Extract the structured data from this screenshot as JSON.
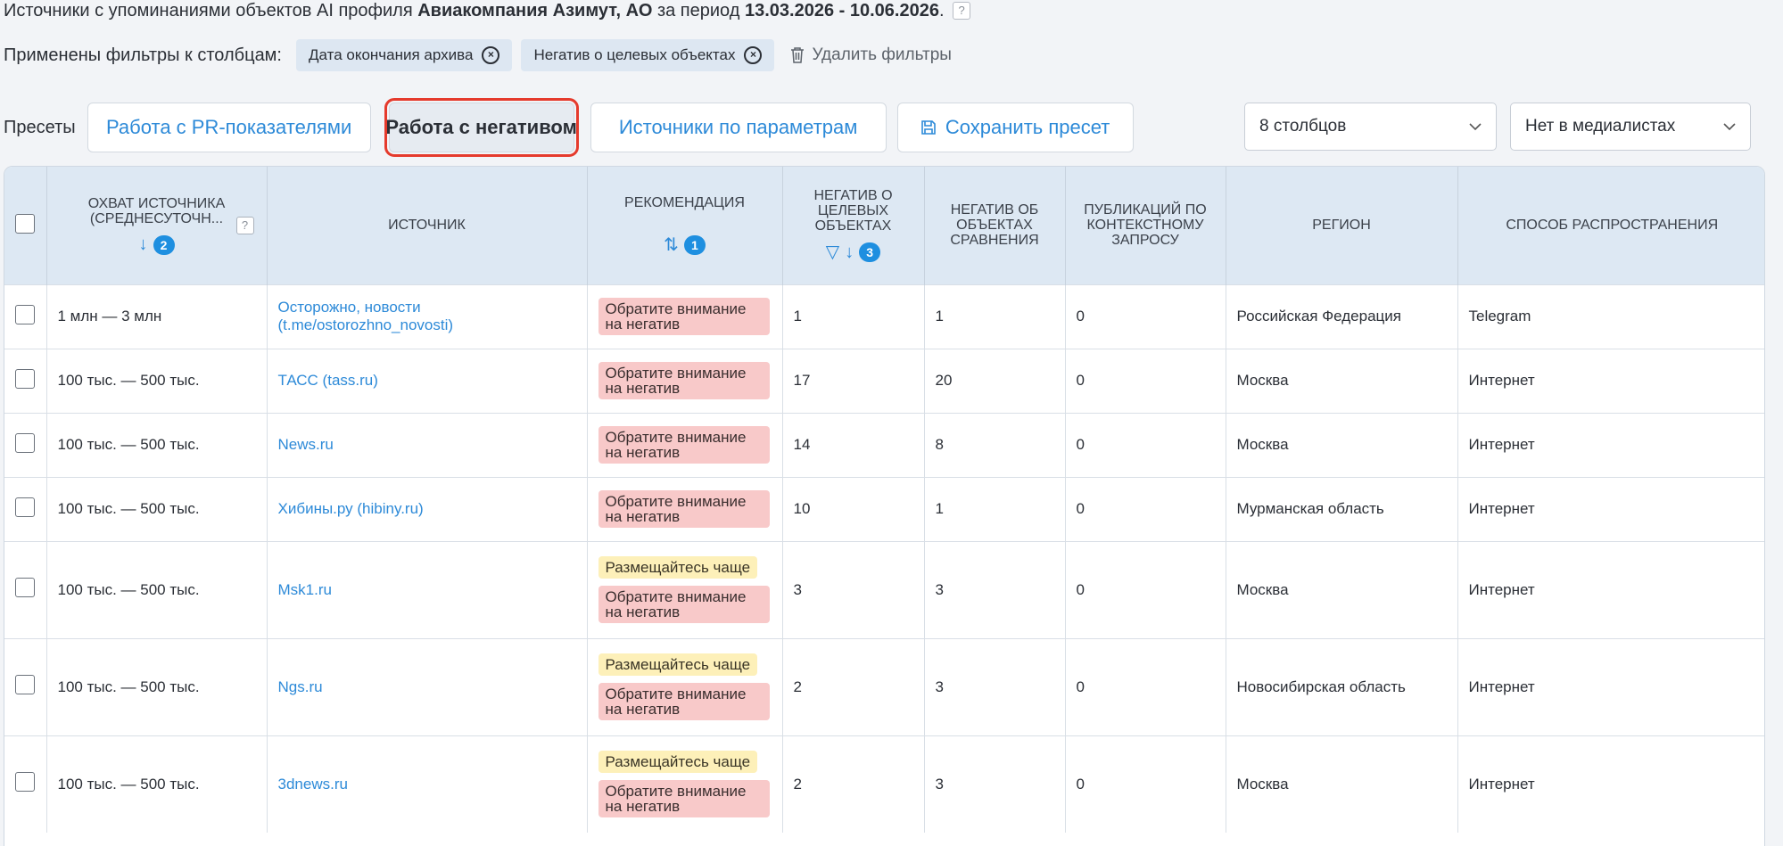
{
  "header": {
    "title_prefix": "Источники с упоминаниями объектов AI профиля ",
    "company": "Авиакомпания Азимут, АО",
    "period_word": " за период ",
    "period": "13.03.2026 - 10.06.2026",
    "dot": ".",
    "help": "?"
  },
  "filters": {
    "label": "Применены фильтры к столбцам:",
    "chips": [
      "Дата окончания архива",
      "Негатив о целевых объектах"
    ],
    "remove_label": "Удалить фильтры"
  },
  "presets": {
    "label": "Пресеты",
    "buttons": [
      "Работа с PR-показателями",
      "Работа с негативом",
      "Источники по параметрам"
    ],
    "active_index": 1,
    "save_label": "Сохранить пресет"
  },
  "selects": {
    "columns": "8 столбцов",
    "media": "Нет в медиалистах"
  },
  "table": {
    "headers": {
      "reach": "ОХВАТ ИСТОЧНИКА (СРЕДНЕСУТОЧН...",
      "reach_sort": "2",
      "source": "ИСТОЧНИК",
      "recommendation": "РЕКОМЕНДАЦИЯ",
      "recommendation_sort": "1",
      "neg_target": "НЕГАТИВ О ЦЕЛЕВЫХ ОБЪЕКТАХ",
      "neg_target_sort": "3",
      "neg_compare": "НЕГАТИВ ОБ ОБЪЕКТАХ СРАВНЕНИЯ",
      "publications": "ПУБЛИКАЦИЙ ПО КОНТЕКСТНОМУ ЗАПРОСУ",
      "region": "РЕГИОН",
      "distribution": "СПОСОБ РАСПРОСТРАНЕНИЯ",
      "help": "?"
    },
    "badges": {
      "neg": "Обратите внимание на негатив",
      "freq": "Размещайтесь чаще"
    },
    "rows": [
      {
        "reach": "1 млн — 3 млн",
        "source": "Осторожно, новости (t.me/ostorozhno_novosti)",
        "freq": false,
        "neg_target": "1",
        "neg_compare": "1",
        "pubs": "0",
        "region": "Российская Федерация",
        "dist": "Telegram"
      },
      {
        "reach": "100 тыс. — 500 тыс.",
        "source": "ТАСС (tass.ru)",
        "freq": false,
        "neg_target": "17",
        "neg_compare": "20",
        "pubs": "0",
        "region": "Москва",
        "dist": "Интернет"
      },
      {
        "reach": "100 тыс. — 500 тыс.",
        "source": "News.ru",
        "freq": false,
        "neg_target": "14",
        "neg_compare": "8",
        "pubs": "0",
        "region": "Москва",
        "dist": "Интернет"
      },
      {
        "reach": "100 тыс. — 500 тыс.",
        "source": "Хибины.ру (hibiny.ru)",
        "freq": false,
        "neg_target": "10",
        "neg_compare": "1",
        "pubs": "0",
        "region": "Мурманская область",
        "dist": "Интернет"
      },
      {
        "reach": "100 тыс. — 500 тыс.",
        "source": "Msk1.ru",
        "freq": true,
        "neg_target": "3",
        "neg_compare": "3",
        "pubs": "0",
        "region": "Москва",
        "dist": "Интернет"
      },
      {
        "reach": "100 тыс. — 500 тыс.",
        "source": "Ngs.ru",
        "freq": true,
        "neg_target": "2",
        "neg_compare": "3",
        "pubs": "0",
        "region": "Новосибирская область",
        "dist": "Интернет"
      },
      {
        "reach": "100 тыс. — 500 тыс.",
        "source": "3dnews.ru",
        "freq": true,
        "neg_target": "2",
        "neg_compare": "3",
        "pubs": "0",
        "region": "Москва",
        "dist": "Интернет"
      }
    ]
  }
}
